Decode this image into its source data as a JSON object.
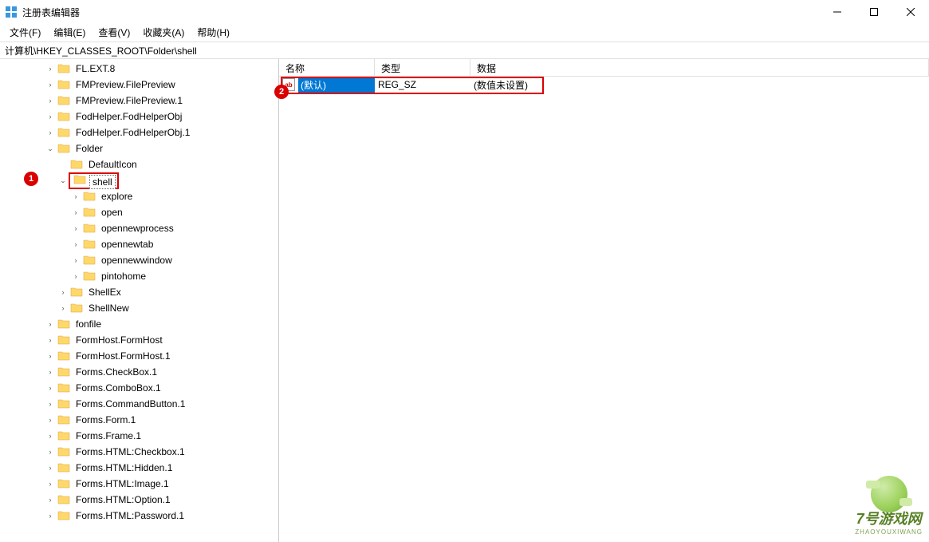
{
  "window": {
    "title": "注册表编辑器"
  },
  "menu": {
    "file": "文件(F)",
    "edit": "编辑(E)",
    "view": "查看(V)",
    "favorites": "收藏夹(A)",
    "help": "帮助(H)"
  },
  "address": "计算机\\HKEY_CLASSES_ROOT\\Folder\\shell",
  "list": {
    "headers": {
      "name": "名称",
      "type": "类型",
      "data": "数据"
    },
    "rows": [
      {
        "icon": "ab",
        "name": "(默认)",
        "type": "REG_SZ",
        "data": "(数值未设置)"
      }
    ]
  },
  "tree": [
    {
      "depth": 2,
      "label": "FL.EXT.8",
      "expander": "closed"
    },
    {
      "depth": 2,
      "label": "FMPreview.FilePreview",
      "expander": "closed"
    },
    {
      "depth": 2,
      "label": "FMPreview.FilePreview.1",
      "expander": "closed"
    },
    {
      "depth": 2,
      "label": "FodHelper.FodHelperObj",
      "expander": "closed"
    },
    {
      "depth": 2,
      "label": "FodHelper.FodHelperObj.1",
      "expander": "closed"
    },
    {
      "depth": 2,
      "label": "Folder",
      "expander": "open"
    },
    {
      "depth": 3,
      "label": "DefaultIcon",
      "expander": "none"
    },
    {
      "depth": 3,
      "label": "shell",
      "expander": "open",
      "selected": true,
      "callout": 1
    },
    {
      "depth": 4,
      "label": "explore",
      "expander": "closed"
    },
    {
      "depth": 4,
      "label": "open",
      "expander": "closed"
    },
    {
      "depth": 4,
      "label": "opennewprocess",
      "expander": "closed"
    },
    {
      "depth": 4,
      "label": "opennewtab",
      "expander": "closed"
    },
    {
      "depth": 4,
      "label": "opennewwindow",
      "expander": "closed"
    },
    {
      "depth": 4,
      "label": "pintohome",
      "expander": "closed"
    },
    {
      "depth": 3,
      "label": "ShellEx",
      "expander": "closed"
    },
    {
      "depth": 3,
      "label": "ShellNew",
      "expander": "closed"
    },
    {
      "depth": 2,
      "label": "fonfile",
      "expander": "closed"
    },
    {
      "depth": 2,
      "label": "FormHost.FormHost",
      "expander": "closed"
    },
    {
      "depth": 2,
      "label": "FormHost.FormHost.1",
      "expander": "closed"
    },
    {
      "depth": 2,
      "label": "Forms.CheckBox.1",
      "expander": "closed"
    },
    {
      "depth": 2,
      "label": "Forms.ComboBox.1",
      "expander": "closed"
    },
    {
      "depth": 2,
      "label": "Forms.CommandButton.1",
      "expander": "closed"
    },
    {
      "depth": 2,
      "label": "Forms.Form.1",
      "expander": "closed"
    },
    {
      "depth": 2,
      "label": "Forms.Frame.1",
      "expander": "closed"
    },
    {
      "depth": 2,
      "label": "Forms.HTML:Checkbox.1",
      "expander": "closed"
    },
    {
      "depth": 2,
      "label": "Forms.HTML:Hidden.1",
      "expander": "closed"
    },
    {
      "depth": 2,
      "label": "Forms.HTML:Image.1",
      "expander": "closed"
    },
    {
      "depth": 2,
      "label": "Forms.HTML:Option.1",
      "expander": "closed"
    },
    {
      "depth": 2,
      "label": "Forms.HTML:Password.1",
      "expander": "closed"
    }
  ],
  "callouts": {
    "one": "1",
    "two": "2"
  },
  "watermark": {
    "text": "7号游戏网",
    "sub": "ZHAOYOUXIWANG"
  }
}
